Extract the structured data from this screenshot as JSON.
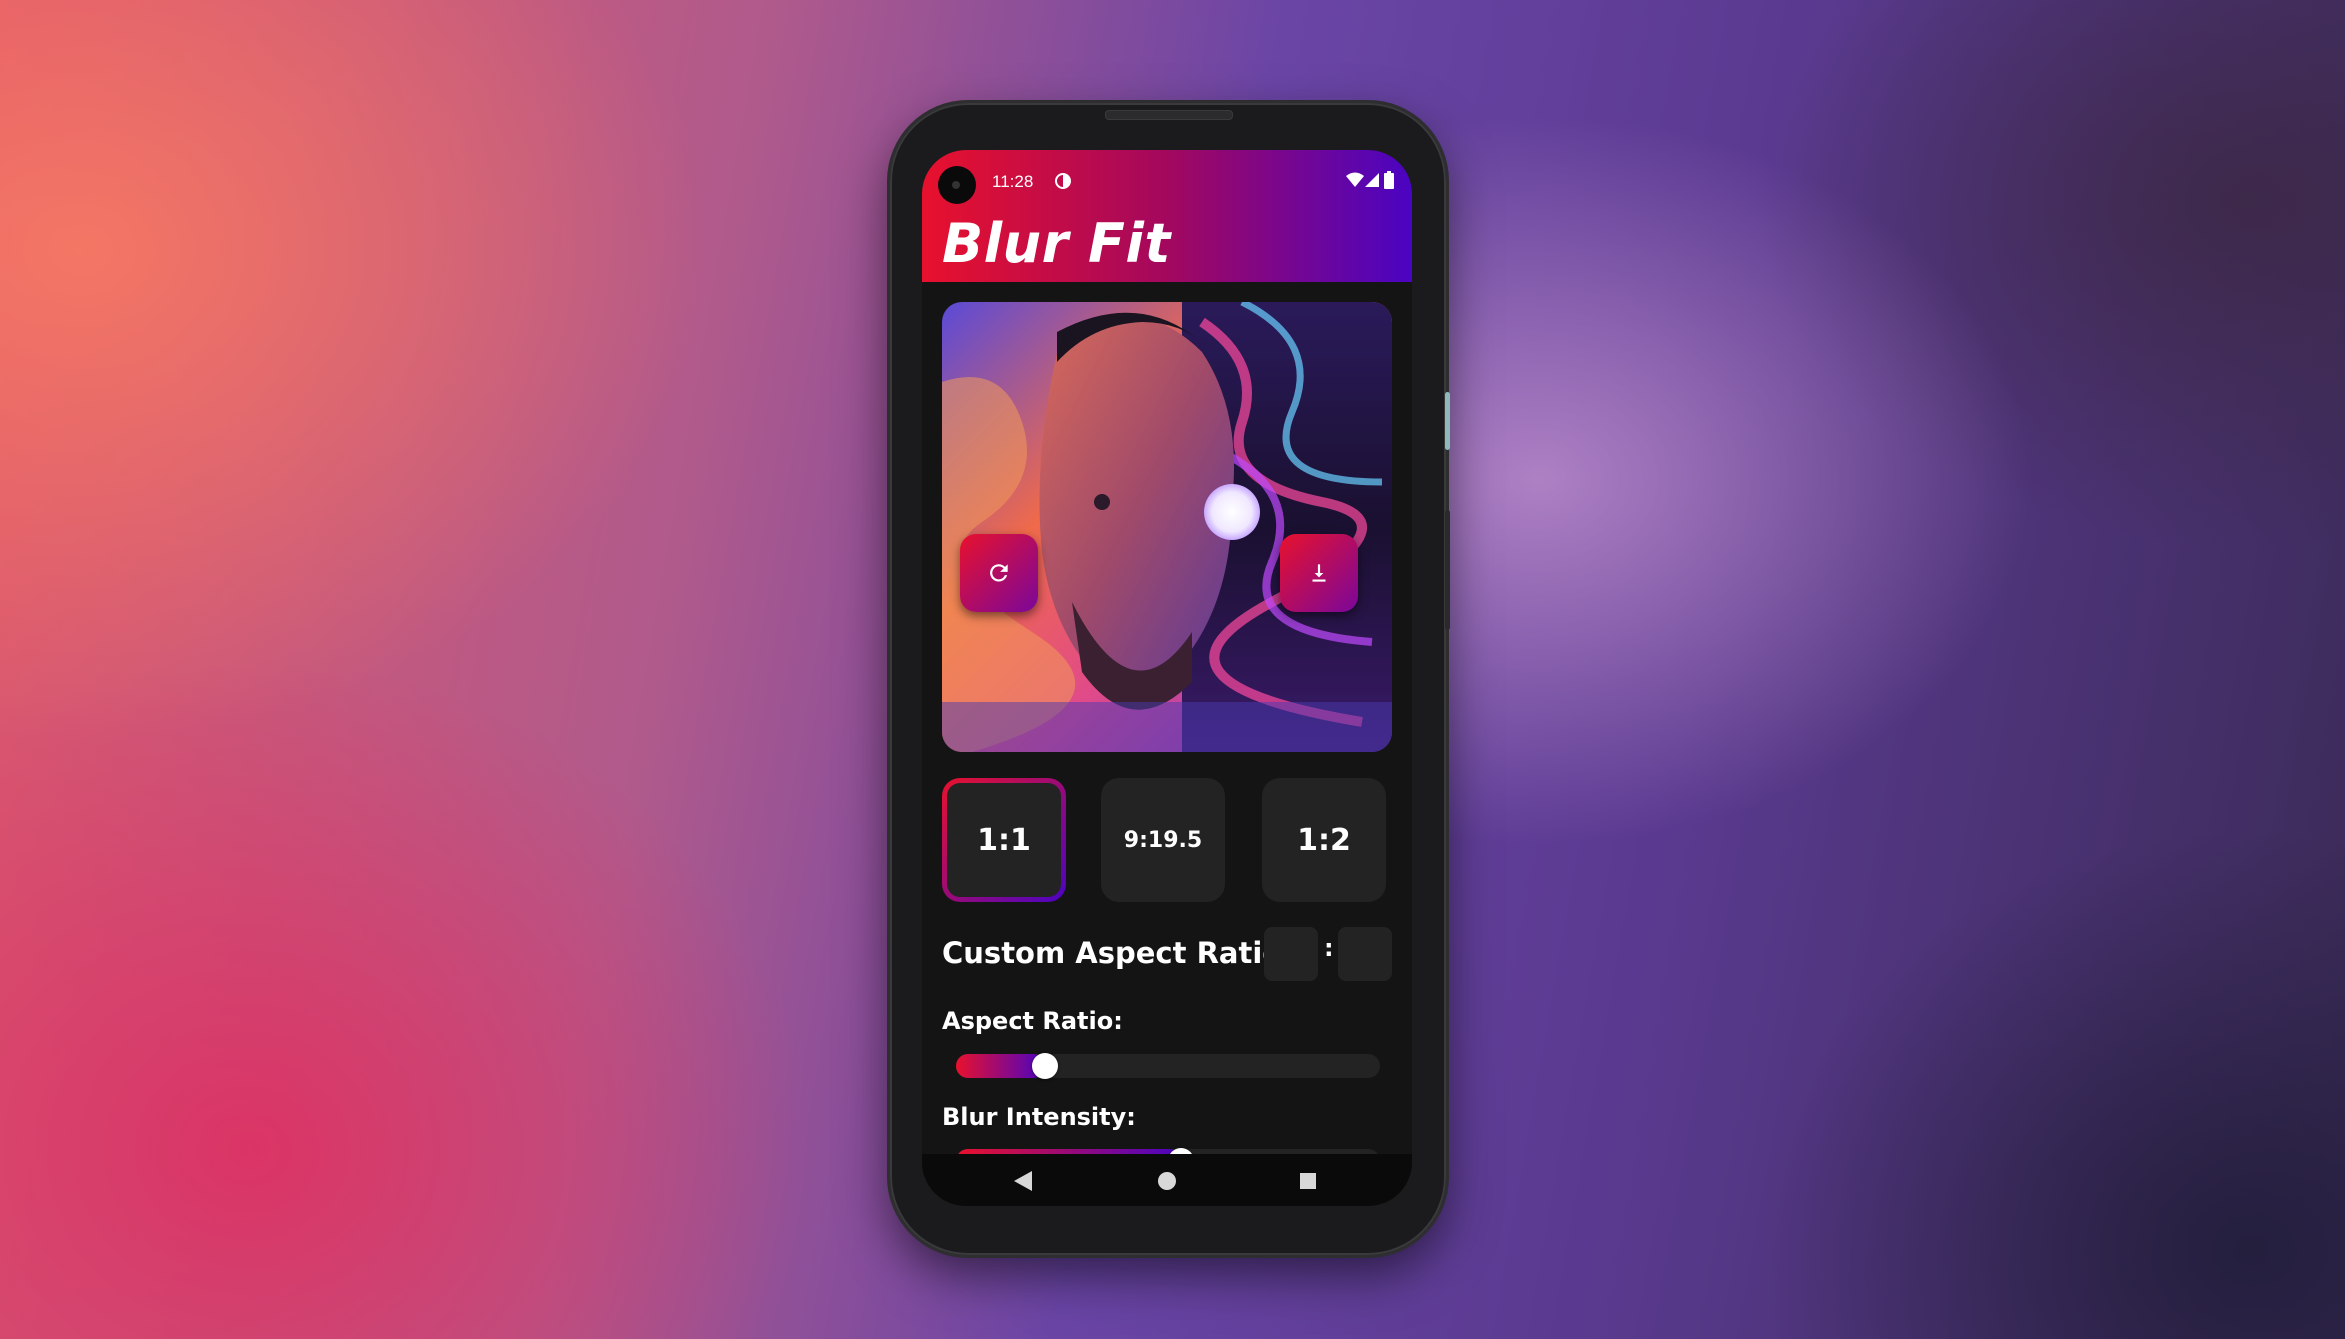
{
  "status_bar": {
    "time": "11:28"
  },
  "app": {
    "title": "Blur Fit"
  },
  "aspect_ratios": [
    {
      "label": "1:1",
      "selected": true
    },
    {
      "label": "9:19.5",
      "selected": false
    },
    {
      "label": "1:2",
      "selected": false
    }
  ],
  "custom_ratio": {
    "label": "Custom Aspect Ratio:",
    "width_value": "",
    "height_value": "",
    "separator": ":"
  },
  "sliders": {
    "aspect_ratio": {
      "label": "Aspect Ratio:",
      "value_fraction": 0.18
    },
    "blur_intensity": {
      "label": "Blur Intensity:",
      "value_fraction": 0.5
    }
  },
  "colors": {
    "accent_start": "#e8112d",
    "accent_mid": "#a3085e",
    "accent_end": "#4a04c2",
    "surface": "#232323",
    "background": "#141414"
  },
  "icons": {
    "reset": "refresh-icon",
    "download": "download-icon",
    "nav_back": "back-triangle-icon",
    "nav_home": "home-circle-icon",
    "nav_recents": "recents-square-icon"
  }
}
